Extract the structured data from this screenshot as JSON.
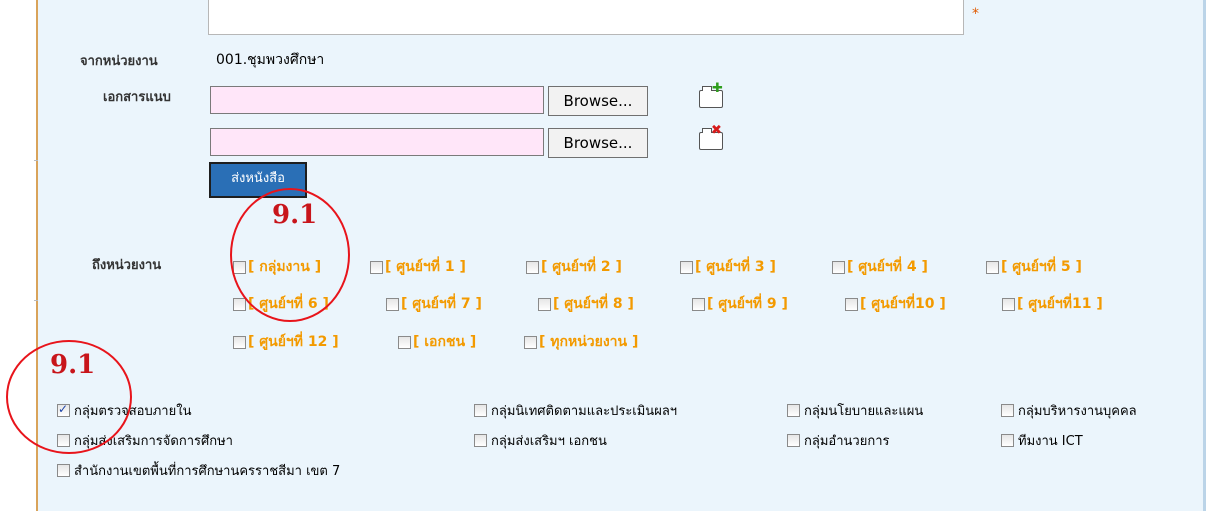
{
  "form": {
    "from_unit_label": "จากหน่วยงาน",
    "from_unit_value": "001.ชุมพวงศึกษา",
    "attachment_label": "เอกสารแนบ",
    "browse_label": "Browse...",
    "send_button": "ส่งหนังสือ",
    "to_unit_label": "ถึงหน่วยงาน",
    "required_mark": "*"
  },
  "units": [
    "[ กลุ่มงาน ]",
    "[ ศูนย์ฯที่ 1 ]",
    "[ ศูนย์ฯที่ 2 ]",
    "[ ศูนย์ฯที่ 3 ]",
    "[ ศูนย์ฯที่ 4 ]",
    "[ ศูนย์ฯที่ 5 ]",
    "[ ศูนย์ฯที่ 6 ]",
    "[ ศูนย์ฯที่ 7 ]",
    "[ ศูนย์ฯที่ 8 ]",
    "[ ศูนย์ฯที่ 9 ]",
    "[ ศูนย์ฯที่10 ]",
    "[ ศูนย์ฯที่11 ]",
    "[ ศูนย์ฯที่ 12 ]",
    "[ เอกชน ]",
    "[ ทุกหน่วยงาน ]"
  ],
  "groups": [
    {
      "label": "กลุ่มตรวจสอบภายใน",
      "checked": true
    },
    {
      "label": "กลุ่มนิเทศติดตามและประเมินผลฯ",
      "checked": false
    },
    {
      "label": "กลุ่มนโยบายและแผน",
      "checked": false
    },
    {
      "label": "กลุ่มบริหารงานบุคคล",
      "checked": false
    },
    {
      "label": "กลุ่มส่งเสริมการจัดการศึกษา",
      "checked": false
    },
    {
      "label": "กลุ่มส่งเสริมฯ เอกชน",
      "checked": false
    },
    {
      "label": "กลุ่มอำนวยการ",
      "checked": false
    },
    {
      "label": "ทีมงาน ICT",
      "checked": false
    },
    {
      "label": "สำนักงานเขตพื้นที่การศึกษานครราชสีมา เขต 7",
      "checked": false
    }
  ],
  "annotations": [
    "9.1",
    "9.1"
  ],
  "colors": {
    "unit_link": "#f39a00",
    "annotation": "#e8141b",
    "panel_bg": "#ebf5fc",
    "file_input_bg": "#ffe6f9",
    "send_button_bg": "#2a6fb6"
  }
}
